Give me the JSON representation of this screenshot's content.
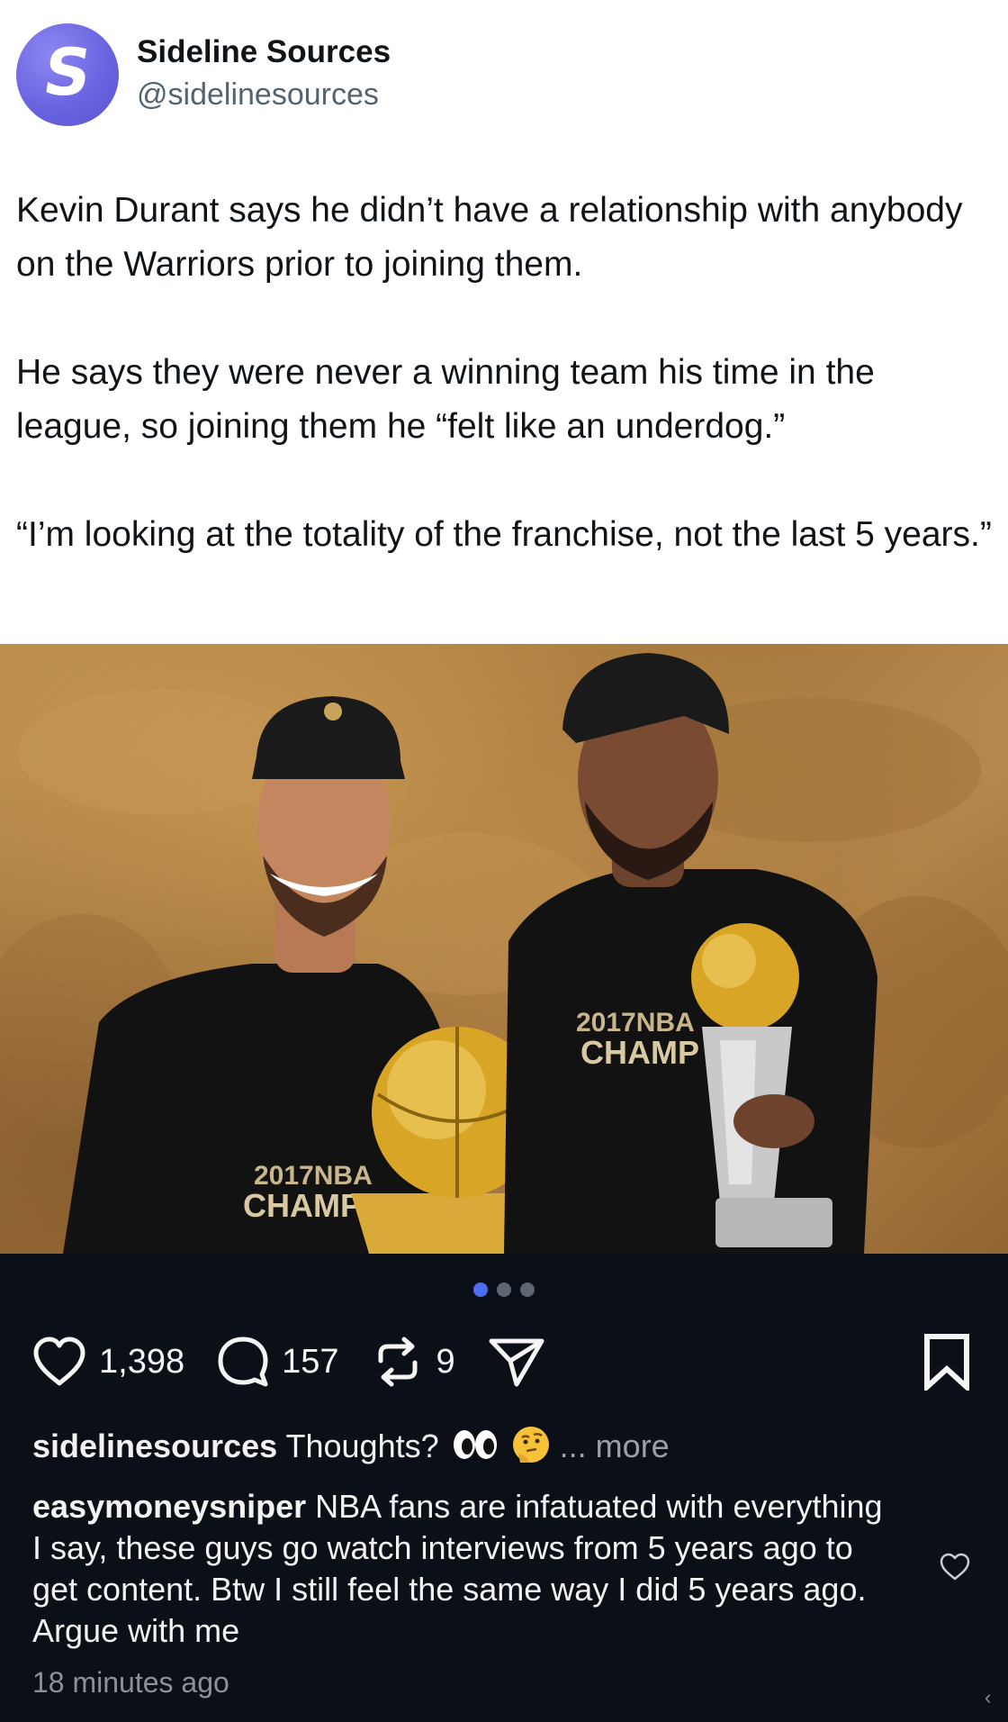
{
  "post": {
    "display_name": "Sideline Sources",
    "handle": "@sidelinesources",
    "avatar_letter": "S",
    "avatar_color": "#6b64e0",
    "paragraphs": [
      "Kevin Durant says he didn’t have a relationship with anybody on the Warriors prior to joining them.",
      "He says they were never a winning team his time in the league, so joining them he “felt like an underdog.”",
      "“I’m looking at the totality of the franchise, not the last 5 years.”"
    ]
  },
  "photo": {
    "description_icon": "photo-image",
    "shirt_text_left": "2017NBA",
    "shirt_text_left_2": "CHAMP",
    "shirt_text_right": "2017NBA",
    "shirt_text_right_2": "CHAMP"
  },
  "carousel": {
    "count": 3,
    "active_index": 0
  },
  "actions": {
    "likes": "1,398",
    "replies": "157",
    "reposts": "9",
    "share_icon": "send-icon",
    "bookmark_icon": "bookmark-icon"
  },
  "caption": {
    "user": "sidelinesources",
    "text": "Thoughts?",
    "emojis": [
      "eyes-emoji",
      "thinking-face-emoji"
    ],
    "more": "... more"
  },
  "comment": {
    "user": "easymoneysniper",
    "text": "NBA fans are infatuated with everything I say, these guys go watch interviews from 5 years ago to get content. Btw I still feel the same way I did 5 years ago. Argue with me"
  },
  "timestamp": "18 minutes ago",
  "colors": {
    "feed_bg": "#0b0f17",
    "accent": "#4c6ef5"
  }
}
